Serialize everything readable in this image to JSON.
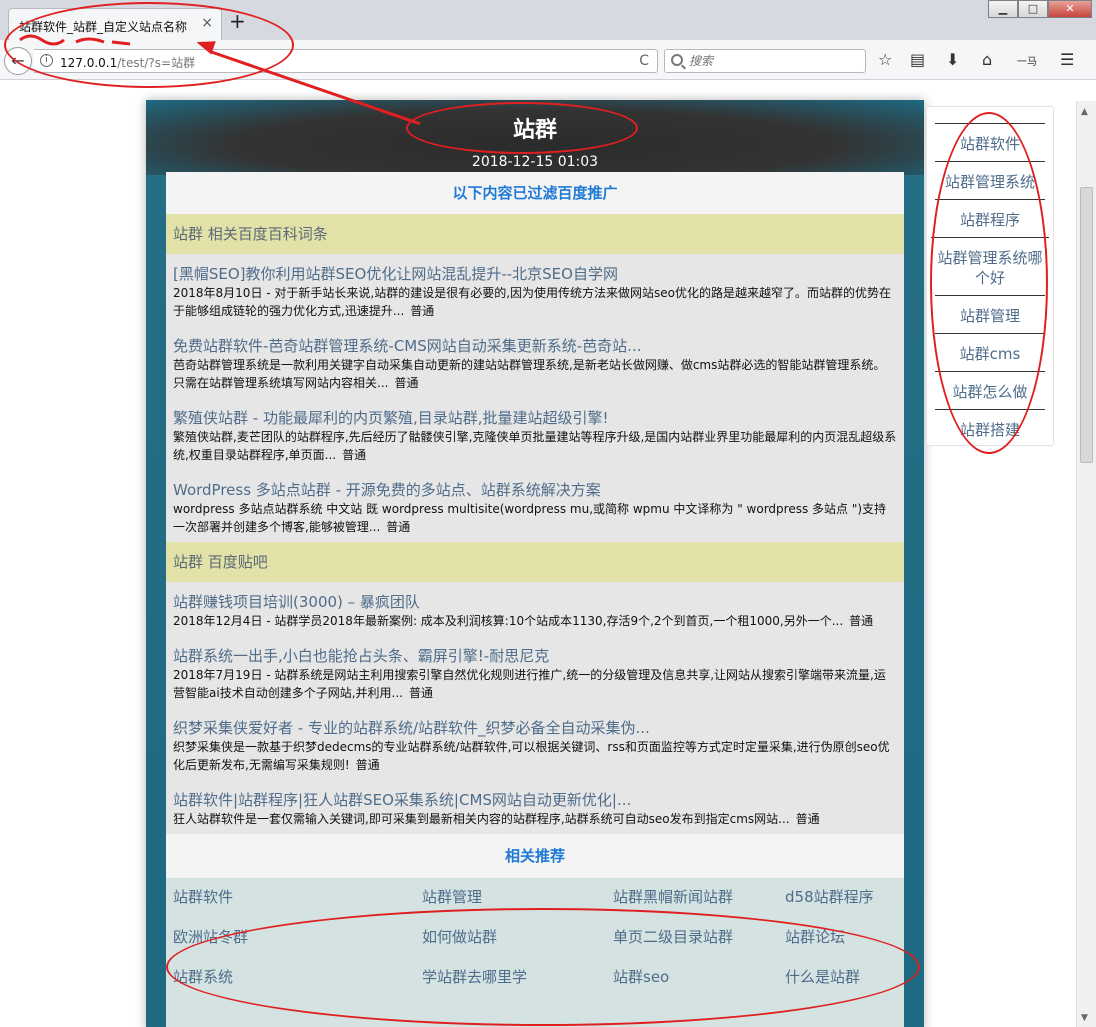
{
  "window": {
    "tab_title": "站群软件_站群_自定义站点名称",
    "tab_close": "×",
    "new_tab": "+",
    "min": "▁",
    "max": "□",
    "close": "✕"
  },
  "navbar": {
    "back": "←",
    "info": "i",
    "url_host": "127.0.0.1",
    "url_path": "/test/?s=站群",
    "reload": "C",
    "search_placeholder": "搜索",
    "ext_label": "一马"
  },
  "page": {
    "site_title": "站群",
    "date": "2018-12-15 01:03",
    "filter_note": "以下内容已过滤百度推广",
    "sections": [
      {
        "heading": "站群 相关百度百科词条",
        "results": [
          {
            "title": "[黑帽SEO]教你利用站群SEO优化让网站混乱提升--北京SEO自学网",
            "desc": "2018年8月10日 - 对于新手站长来说,站群的建设是很有必要的,因为使用传统方法来做网站seo优化的路是越来越窄了。而站群的优势在于能够组成链轮的强力优化方式,迅速提升...",
            "more": "普通"
          },
          {
            "title": "免费站群软件-芭奇站群管理系统-CMS网站自动采集更新系统-芭奇站...",
            "desc": "芭奇站群管理系统是一款利用关键字自动采集自动更新的建站站群管理系统,是新老站长做网赚、做cms站群必选的智能站群管理系统。只需在站群管理系统填写网站内容相关...",
            "more": "普通"
          },
          {
            "title": "繁殖侠站群 - 功能最犀利的内页繁殖,目录站群,批量建站超级引擎!",
            "desc": "繁殖侠站群,麦芒团队的站群程序,先后经历了骷髅侠引擎,克隆侠单页批量建站等程序升级,是国内站群业界里功能最犀利的内页混乱超级系统,权重目录站群程序,单页面...",
            "more": "普通"
          },
          {
            "title": "WordPress 多站点站群 - 开源免费的多站点、站群系统解决方案",
            "desc": "wordpress 多站点站群系统 中文站 既 wordpress multisite(wordpress mu,或简称 wpmu 中文译称为 \" wordpress 多站点 \")支持一次部署并创建多个博客,能够被管理...",
            "more": "普通"
          }
        ]
      },
      {
        "heading": "站群 百度贴吧",
        "results": [
          {
            "title": "站群赚钱项目培训(3000) – 暴疯团队",
            "desc": "2018年12月4日 - 站群学员2018年最新案例:  成本及利润核算:10个站成本1130,存活9个,2个到首页,一个租1000,另外一个...",
            "more": "普通"
          },
          {
            "title": "站群系统一出手,小白也能抢占头条、霸屏引擎!-耐思尼克",
            "desc": "2018年7月19日 - 站群系统是网站主利用搜索引擎自然优化规则进行推广,统一的分级管理及信息共享,让网站从搜索引擎端带来流量,运营智能ai技术自动创建多个子网站,并利用...",
            "more": "普通"
          },
          {
            "title": "织梦采集侠爱好者 - 专业的站群系统/站群软件_织梦必备全自动采集伪...",
            "desc": "织梦采集侠是一款基于织梦dedecms的专业站群系统/站群软件,可以根据关键词、rss和页面监控等方式定时定量采集,进行伪原创seo优化后更新发布,无需编写采集规则!",
            "more": "普通"
          },
          {
            "title": "站群软件|站群程序|狂人站群SEO采集系统|CMS网站自动更新优化|...",
            "desc": "狂人站群软件是一套仅需输入关键词,即可采集到最新相关内容的站群程序,站群系统可自动seo发布到指定cms网站...",
            "more": "普通"
          }
        ]
      }
    ],
    "recommend_title": "相关推荐",
    "recommend": [
      [
        "站群软件",
        "站群管理",
        "站群黑帽新闻站群",
        "d58站群程序"
      ],
      [
        "欧洲站冬群",
        "如何做站群",
        "单页二级目录站群",
        "站群论坛"
      ],
      [
        "站群系统",
        "学站群去哪里学",
        "站群seo",
        "什么是站群"
      ]
    ]
  },
  "sidebar": {
    "items": [
      "站群软件",
      "站群管理系统",
      "站群程序",
      "站群管理系统哪个好",
      "站群管理",
      "站群cms",
      "站群怎么做",
      "站群搭建"
    ]
  },
  "colors": {
    "accent_blue": "#1f7ad6",
    "link": "#4f6c8a",
    "section_bg": "#e1e1a8",
    "annotation_red": "#e02020"
  }
}
